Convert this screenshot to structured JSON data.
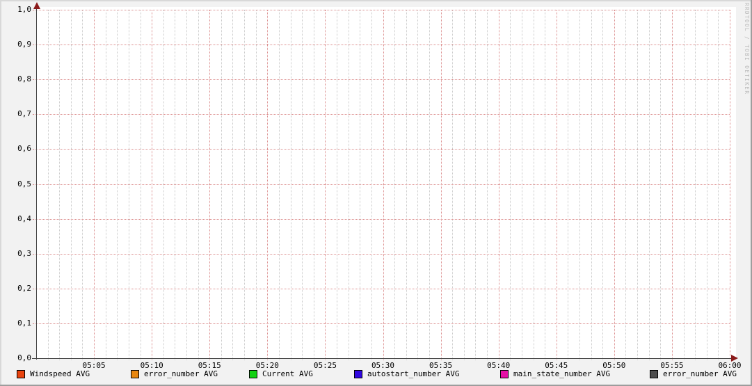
{
  "watermark": "RRDTOOL / TOBI OETIKER",
  "chart_data": {
    "type": "line",
    "title": "",
    "xlabel": "",
    "ylabel": "",
    "xlim": [
      "05:00",
      "06:00"
    ],
    "ylim": [
      0.0,
      1.0
    ],
    "y_major_step": 0.1,
    "x_major_step_minutes": 5,
    "x_minor_step_minutes": 1,
    "grid": "on",
    "legend_position": "bottom",
    "decimal_separator": ",",
    "x_ticks": [
      "05:05",
      "05:10",
      "05:15",
      "05:20",
      "05:25",
      "05:30",
      "05:35",
      "05:40",
      "05:45",
      "05:50",
      "05:55",
      "06:00"
    ],
    "y_ticks": [
      "1,0",
      "0,9",
      "0,8",
      "0,7",
      "0,6",
      "0,5",
      "0,4",
      "0,3",
      "0,2",
      "0,1",
      "0,0"
    ],
    "series": [
      {
        "name": "Windspeed AVG",
        "color": "#e8430e",
        "values": []
      },
      {
        "name": "error_number AVG",
        "color": "#e8860d",
        "values": []
      },
      {
        "name": "Current AVG",
        "color": "#12d112",
        "values": []
      },
      {
        "name": "autostart_number AVG",
        "color": "#3007df",
        "values": []
      },
      {
        "name": "main_state_number AVG",
        "color": "#e50fa5",
        "values": []
      },
      {
        "name": "error_number AVG",
        "color": "#4d4d4d",
        "values": []
      }
    ],
    "colors": {
      "background": "#f2f2f2",
      "canvas": "#ffffff",
      "major_grid": "#db8c8c",
      "minor_grid": "#c9c9c9",
      "axis": "#454545",
      "arrow": "#8b1a1a",
      "watermark_text": "#b9b9b9"
    }
  }
}
